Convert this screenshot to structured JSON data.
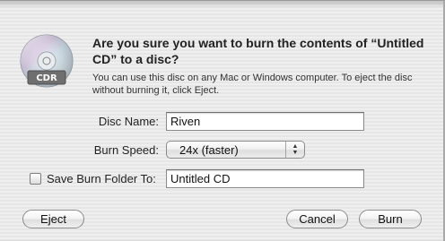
{
  "dialog": {
    "title": "Are you sure you want to burn the contents of “Untitled CD” to a disc?",
    "message": "You can use this disc on any Mac or Windows computer. To eject the disc without burning it, click Eject.",
    "icon": {
      "name": "cdr-disc-icon",
      "label": "CDR"
    }
  },
  "form": {
    "disc_name": {
      "label": "Disc Name:",
      "value": "Riven"
    },
    "burn_speed": {
      "label": "Burn Speed:",
      "selected": "24x (faster)"
    },
    "save_burn_folder": {
      "label": "Save Burn Folder To:",
      "checked": false,
      "value": "Untitled CD"
    }
  },
  "buttons": {
    "eject": "Eject",
    "cancel": "Cancel",
    "burn": "Burn"
  }
}
